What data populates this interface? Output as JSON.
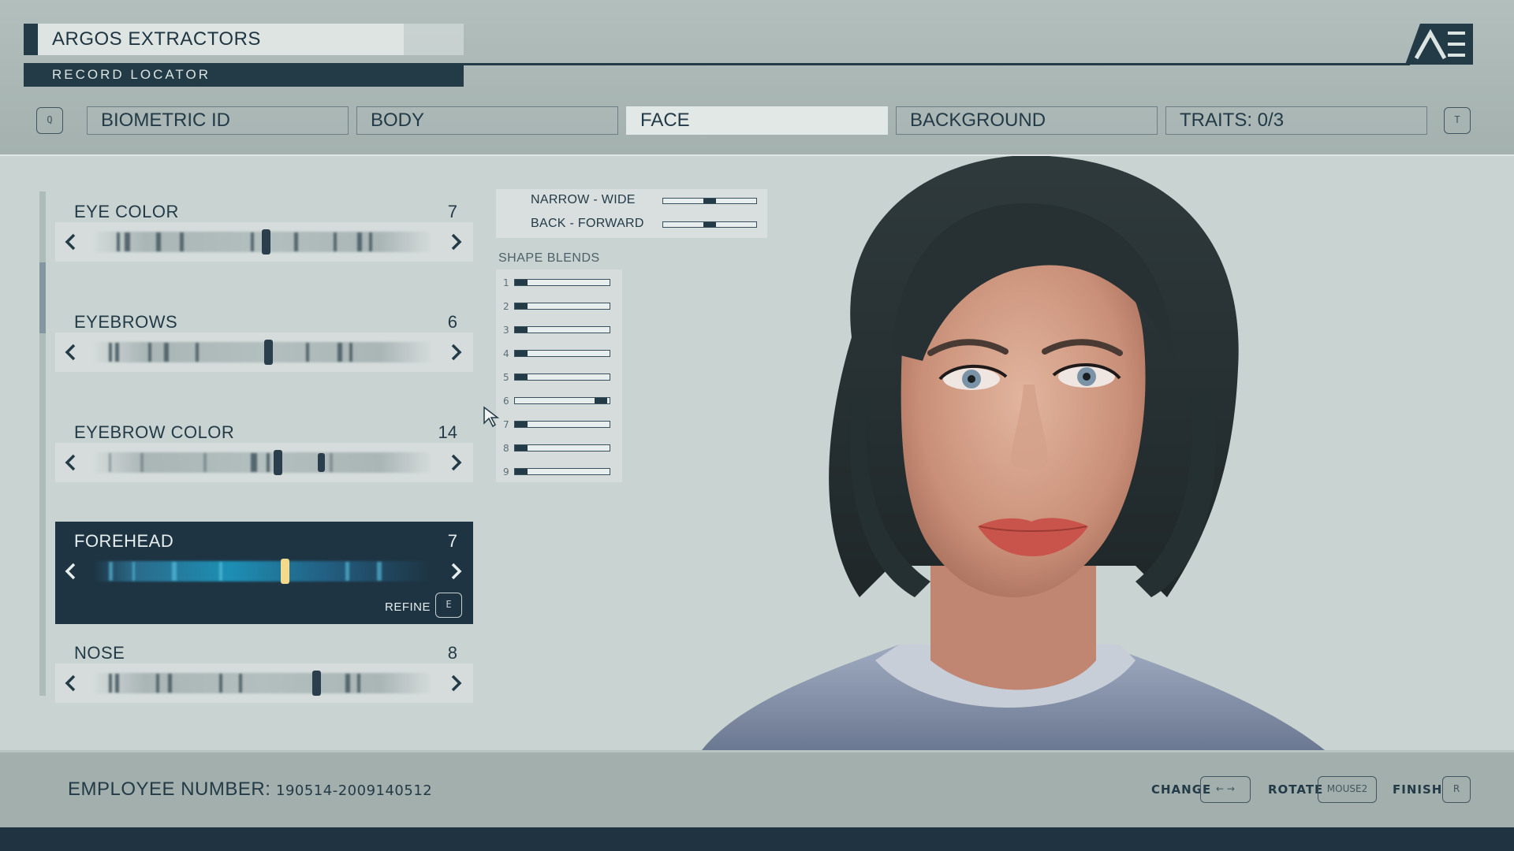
{
  "header": {
    "company": "ARGOS EXTRACTORS",
    "record_locator": "RECORD LOCATOR",
    "logo": "constellation-logo"
  },
  "tabs": {
    "prev_key": "Q",
    "next_key": "T",
    "items": [
      {
        "label": "BIOMETRIC ID",
        "active": false
      },
      {
        "label": "BODY",
        "active": false
      },
      {
        "label": "FACE",
        "active": true
      },
      {
        "label": "BACKGROUND",
        "active": false
      },
      {
        "label": "TRAITS: 0/3",
        "active": false
      }
    ]
  },
  "options": [
    {
      "label": "EYE COLOR",
      "value": "7"
    },
    {
      "label": "EYEBROWS",
      "value": "6"
    },
    {
      "label": "EYEBROW COLOR",
      "value": "14"
    },
    {
      "label": "FOREHEAD",
      "value": "7",
      "selected": true,
      "refine_label": "REFINE",
      "refine_key": "E"
    },
    {
      "label": "NOSE",
      "value": "8"
    }
  ],
  "fine_tune": [
    {
      "label": "NARROW - WIDE",
      "level": 0.5
    },
    {
      "label": "BACK - FORWARD",
      "level": 0.5
    }
  ],
  "shape_blends": {
    "title": "SHAPE BLENDS",
    "items": [
      {
        "num": "1",
        "level": 0.1
      },
      {
        "num": "2",
        "level": 0.1
      },
      {
        "num": "3",
        "level": 0.1
      },
      {
        "num": "4",
        "level": 0.1
      },
      {
        "num": "5",
        "level": 0.1
      },
      {
        "num": "6",
        "level": 0.9
      },
      {
        "num": "7",
        "level": 0.1
      },
      {
        "num": "8",
        "level": 0.1
      },
      {
        "num": "9",
        "level": 0.1
      }
    ]
  },
  "footer": {
    "employee_label": "EMPLOYEE NUMBER:",
    "employee_number": "190514-2009140512",
    "hints": [
      {
        "label": "CHANGE",
        "key": "← →"
      },
      {
        "label": "ROTATE",
        "key": "MOUSE2"
      },
      {
        "label": "FINISH",
        "key": "R"
      }
    ]
  },
  "colors": {
    "dark": "#233a47",
    "selected_bg": "#1e3442",
    "active_tab": "#e2e8e6",
    "background": "#c9d3d1"
  }
}
